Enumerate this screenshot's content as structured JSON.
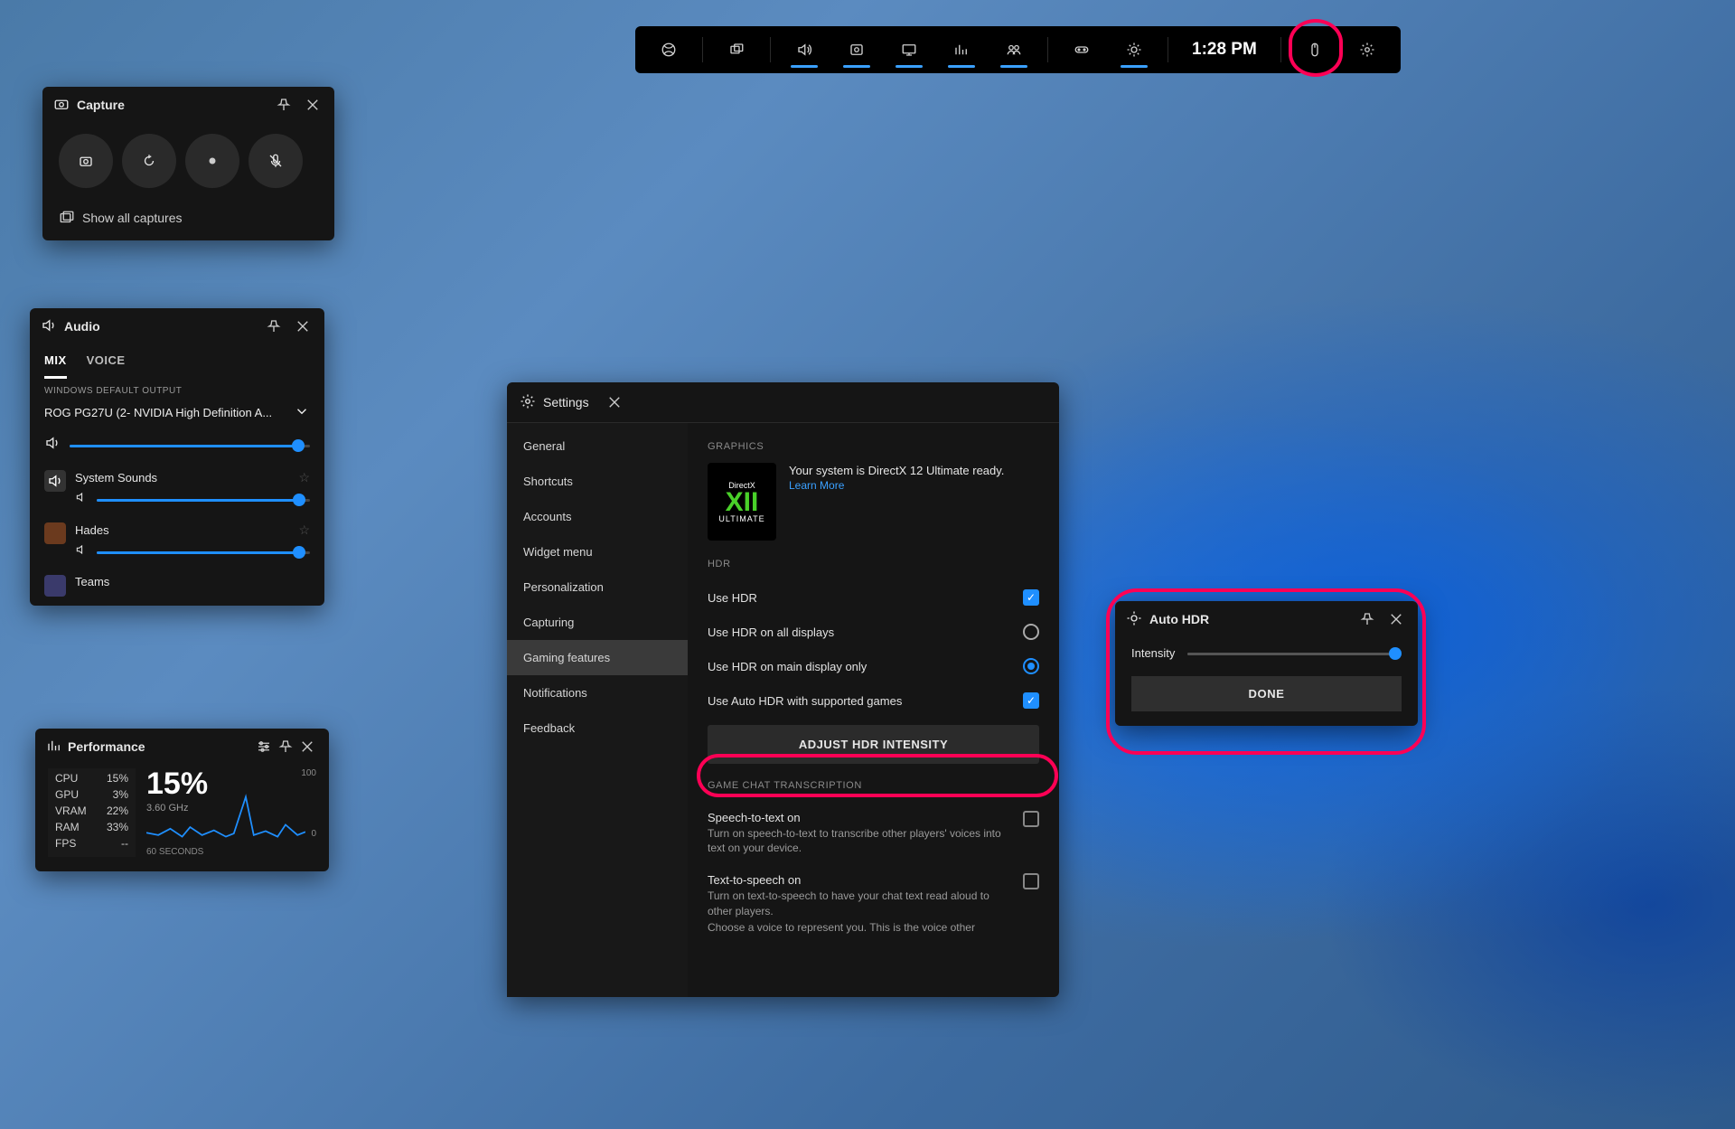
{
  "gamebar": {
    "time": "1:28 PM"
  },
  "capture": {
    "title": "Capture",
    "show_all": "Show all captures"
  },
  "audio": {
    "title": "Audio",
    "tab_mix": "MIX",
    "tab_voice": "VOICE",
    "default_label": "WINDOWS DEFAULT OUTPUT",
    "output_device": "ROG PG27U (2- NVIDIA High Definition A...",
    "apps": {
      "system": "System Sounds",
      "hades": "Hades",
      "teams": "Teams"
    }
  },
  "perf": {
    "title": "Performance",
    "cpu_l": "CPU",
    "cpu_v": "15%",
    "gpu_l": "GPU",
    "gpu_v": "3%",
    "vram_l": "VRAM",
    "vram_v": "22%",
    "ram_l": "RAM",
    "ram_v": "33%",
    "fps_l": "FPS",
    "fps_v": "--",
    "big": "15%",
    "ghz": "3.60 GHz",
    "gmax": "100",
    "gmin": "0",
    "gx": "60 SECONDS"
  },
  "settings": {
    "title": "Settings",
    "nav": {
      "general": "General",
      "shortcuts": "Shortcuts",
      "accounts": "Accounts",
      "widget": "Widget menu",
      "personalization": "Personalization",
      "capturing": "Capturing",
      "gaming": "Gaming features",
      "notifications": "Notifications",
      "feedback": "Feedback"
    },
    "grp_graphics": "GRAPHICS",
    "dx_top": "DirectX",
    "dx_mid": "XII",
    "dx_bot": "ULTIMATE",
    "dx_msg": "Your system is DirectX 12 Ultimate ready.",
    "dx_link": "Learn More",
    "grp_hdr": "HDR",
    "opt_use_hdr": "Use HDR",
    "opt_all": "Use HDR on all displays",
    "opt_main": "Use HDR on main display only",
    "opt_auto": "Use Auto HDR with supported games",
    "btn_adjust": "ADJUST HDR INTENSITY",
    "grp_chat": "GAME CHAT TRANSCRIPTION",
    "opt_stt": "Speech-to-text on",
    "opt_stt_sub": "Turn on speech-to-text to transcribe other players' voices into text on your device.",
    "opt_tts": "Text-to-speech on",
    "opt_tts_sub": "Turn on text-to-speech to have your chat text read aloud to other players.",
    "opt_tts_sub2": "Choose a voice to represent you. This is the voice other"
  },
  "ahdr": {
    "title": "Auto HDR",
    "intensity": "Intensity",
    "done": "DONE"
  }
}
